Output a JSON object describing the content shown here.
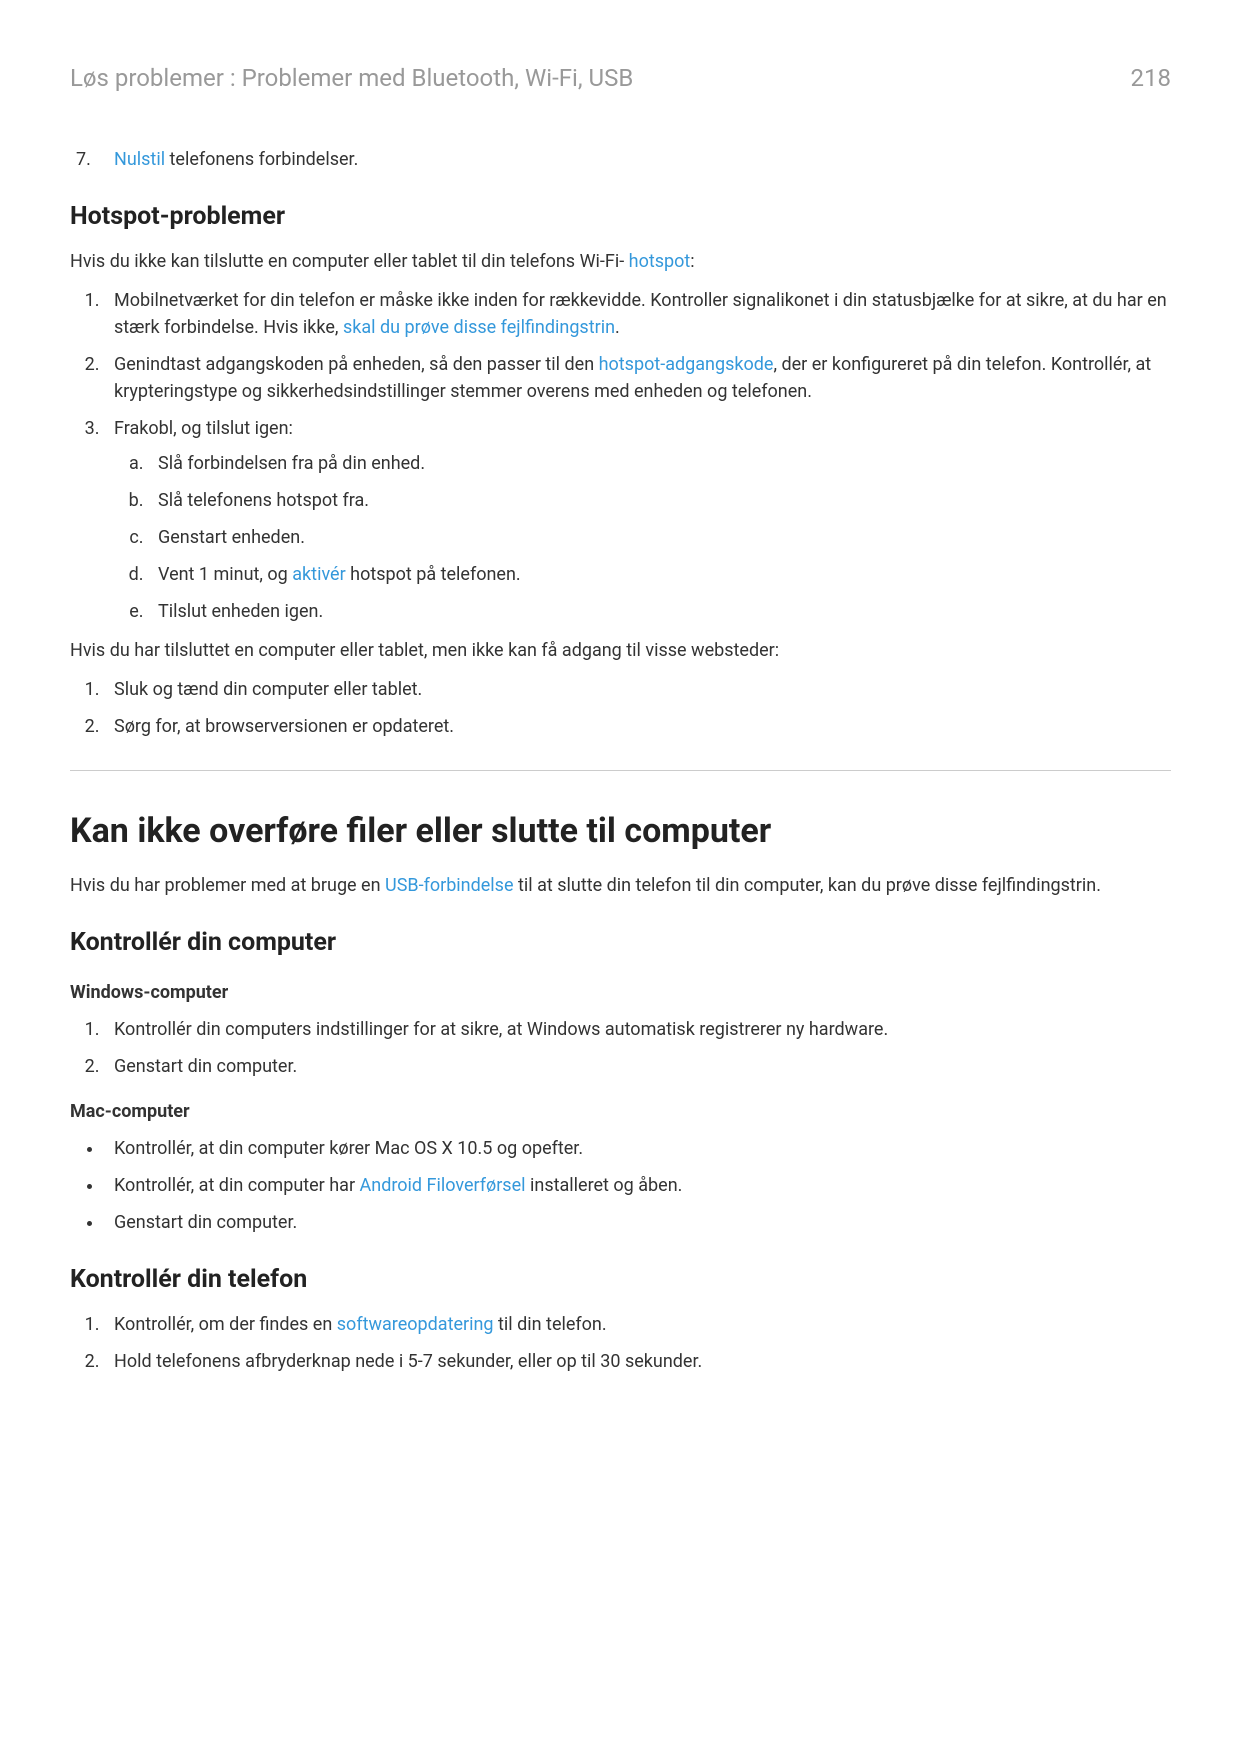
{
  "header": {
    "breadcrumb": "Løs problemer : Problemer med Bluetooth, Wi-Fi, USB",
    "page": "218"
  },
  "step7": {
    "link": "Nulstil",
    "rest": " telefonens forbindelser."
  },
  "hotspot": {
    "heading": "Hotspot-problemer",
    "intro_a": "Hvis du ikke kan tilslutte en computer eller tablet til din telefons Wi-Fi- ",
    "intro_link": "hotspot",
    "intro_b": ":",
    "li1_a": "Mobilnetværket for din telefon er måske ikke inden for rækkevidde. Kontroller signalikonet i din statusbjælke for at sikre, at du har en stærk forbindelse. Hvis ikke, ",
    "li1_link": "skal du prøve disse fejlfindingstrin",
    "li1_b": ".",
    "li2_a": "Genindtast adgangskoden på enheden, så den passer til den ",
    "li2_link": "hotspot-adgangskode",
    "li2_b": ", der er konfigureret på din telefon. Kontrollér, at krypteringstype og sikkerhedsindstillinger stemmer overens med enheden og telefonen.",
    "li3": "Frakobl, og tilslut igen:",
    "sub": {
      "a": "Slå forbindelsen fra på din enhed.",
      "b": "Slå telefonens hotspot fra.",
      "c": "Genstart enheden.",
      "d_a": "Vent 1 minut, og ",
      "d_link": "aktivér",
      "d_b": " hotspot på telefonen.",
      "e": "Tilslut enheden igen."
    },
    "mid": "Hvis du har tilsluttet en computer eller tablet, men ikke kan få adgang til visse websteder:",
    "mid_li1": "Sluk og tænd din computer eller tablet.",
    "mid_li2": "Sørg for, at browserversionen er opdateret."
  },
  "transfer": {
    "heading": "Kan ikke overføre filer eller slutte til computer",
    "intro_a": "Hvis du har problemer med at bruge en ",
    "intro_link": "USB-forbindelse",
    "intro_b": " til at slutte din telefon til din computer, kan du prøve disse fejlfindingstrin."
  },
  "checkpc": {
    "heading": "Kontrollér din computer",
    "win_head": "Windows-computer",
    "win_li1": "Kontrollér din computers indstillinger for at sikre, at Windows automatisk registrerer ny hardware.",
    "win_li2": "Genstart din computer.",
    "mac_head": "Mac-computer",
    "mac_li1": "Kontrollér, at din computer kører Mac OS X 10.5 og opefter.",
    "mac_li2_a": "Kontrollér, at din computer har ",
    "mac_li2_link": "Android Filoverførsel",
    "mac_li2_b": " installeret og åben.",
    "mac_li3": "Genstart din computer."
  },
  "checkphone": {
    "heading": "Kontrollér din telefon",
    "li1_a": "Kontrollér, om der findes en ",
    "li1_link": "softwareopdatering",
    "li1_b": " til din telefon.",
    "li2": "Hold telefonens afbryderknap nede i 5-7 sekunder, eller op til 30 sekunder."
  }
}
